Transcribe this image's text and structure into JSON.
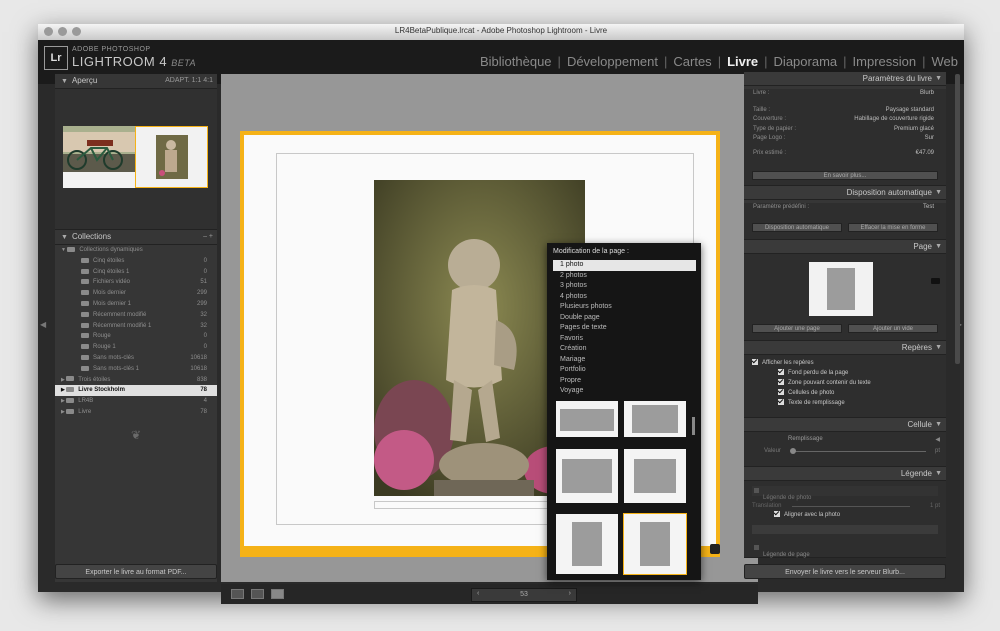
{
  "window": {
    "title": "LR4BetaPublique.lrcat - Adobe Photoshop Lightroom - Livre"
  },
  "identity": {
    "brand_small": "ADOBE PHOTOSHOP",
    "brand_large": "LIGHTROOM 4",
    "beta": "BETA",
    "logo": "Lr"
  },
  "modules": [
    {
      "label": "Bibliothèque",
      "active": false
    },
    {
      "label": "Développement",
      "active": false
    },
    {
      "label": "Cartes",
      "active": false
    },
    {
      "label": "Livre",
      "active": true
    },
    {
      "label": "Diaporama",
      "active": false
    },
    {
      "label": "Impression",
      "active": false
    },
    {
      "label": "Web",
      "active": false
    }
  ],
  "left": {
    "preview": {
      "title": "Aperçu",
      "zoom": "ADAPT.  1:1  4:1"
    },
    "collections": {
      "title": "Collections",
      "controls": "–  +",
      "rows": [
        {
          "label": "Collections dynamiques",
          "count": "",
          "level": 0
        },
        {
          "label": "Cinq étoiles",
          "count": "0",
          "level": 1
        },
        {
          "label": "Cinq étoiles 1",
          "count": "0",
          "level": 1
        },
        {
          "label": "Fichiers vidéo",
          "count": "51",
          "level": 1
        },
        {
          "label": "Mois dernier",
          "count": "299",
          "level": 1
        },
        {
          "label": "Mois dernier 1",
          "count": "299",
          "level": 1
        },
        {
          "label": "Récemment modifié",
          "count": "32",
          "level": 1
        },
        {
          "label": "Récemment modifié 1",
          "count": "32",
          "level": 1
        },
        {
          "label": "Rouge",
          "count": "0",
          "level": 1
        },
        {
          "label": "Rouge 1",
          "count": "0",
          "level": 1
        },
        {
          "label": "Sans mots-clés",
          "count": "10618",
          "level": 1
        },
        {
          "label": "Sans mots-clés 1",
          "count": "10618",
          "level": 1
        },
        {
          "label": "Trois étoiles",
          "count": "838",
          "level": 0
        },
        {
          "label": "Livre Stockholm",
          "count": "78",
          "level": 0,
          "selected": true
        },
        {
          "label": "LR4B",
          "count": "4",
          "level": 0
        },
        {
          "label": "Livre",
          "count": "78",
          "level": 0
        }
      ]
    },
    "export_button": "Exporter le livre au format PDF..."
  },
  "toolbar": {
    "page": "53"
  },
  "popup": {
    "title": "Modification de la page :",
    "options": [
      "1 photo",
      "2 photos",
      "3 photos",
      "4 photos",
      "Plusieurs photos",
      "Double page",
      "Pages de texte",
      "Favoris",
      "Création",
      "Mariage",
      "Portfolio",
      "Propre",
      "Voyage"
    ],
    "selected": "1 photo"
  },
  "right": {
    "book_settings": {
      "title": "Paramètres du livre",
      "livre_label": "Livre :",
      "livre_value": "Blurb",
      "rows": [
        {
          "label": "Taille :",
          "value": "Paysage standard"
        },
        {
          "label": "Couverture :",
          "value": "Habillage de couverture rigide"
        },
        {
          "label": "Type de papier :",
          "value": "Premium glacé"
        },
        {
          "label": "Page Logo :",
          "value": "Sur"
        }
      ],
      "price_label": "Prix estimé :",
      "price_value": "€47.09",
      "more_button": "En savoir plus..."
    },
    "auto_layout": {
      "title": "Disposition automatique",
      "preset_label": "Paramètre prédéfini :",
      "preset_value": "Test",
      "auto_button": "Disposition automatique",
      "clear_button": "Effacer la mise en forme"
    },
    "page": {
      "title": "Page",
      "add_page": "Ajouter une page",
      "add_blank": "Ajouter un vide"
    },
    "guides": {
      "title": "Repères",
      "show": "Afficher les repères",
      "items": [
        "Fond perdu de la page",
        "Zone pouvant contenir du texte",
        "Cellules de photo",
        "Texte de remplissage"
      ]
    },
    "cell": {
      "title": "Cellule",
      "fill": "Remplissage",
      "slider_label": "Valeur",
      "unit": "pt"
    },
    "caption": {
      "title": "Légende",
      "photo_caption": "Légende de photo",
      "offset_label": "Translation",
      "offset_value": "1 pt",
      "align": "Aligner avec la photo",
      "page_caption": "Légende de page"
    },
    "send_button": "Envoyer le livre vers le serveur Blurb..."
  },
  "colors": {
    "accent": "#f5b217",
    "panel": "#363636",
    "background": "#979797"
  }
}
